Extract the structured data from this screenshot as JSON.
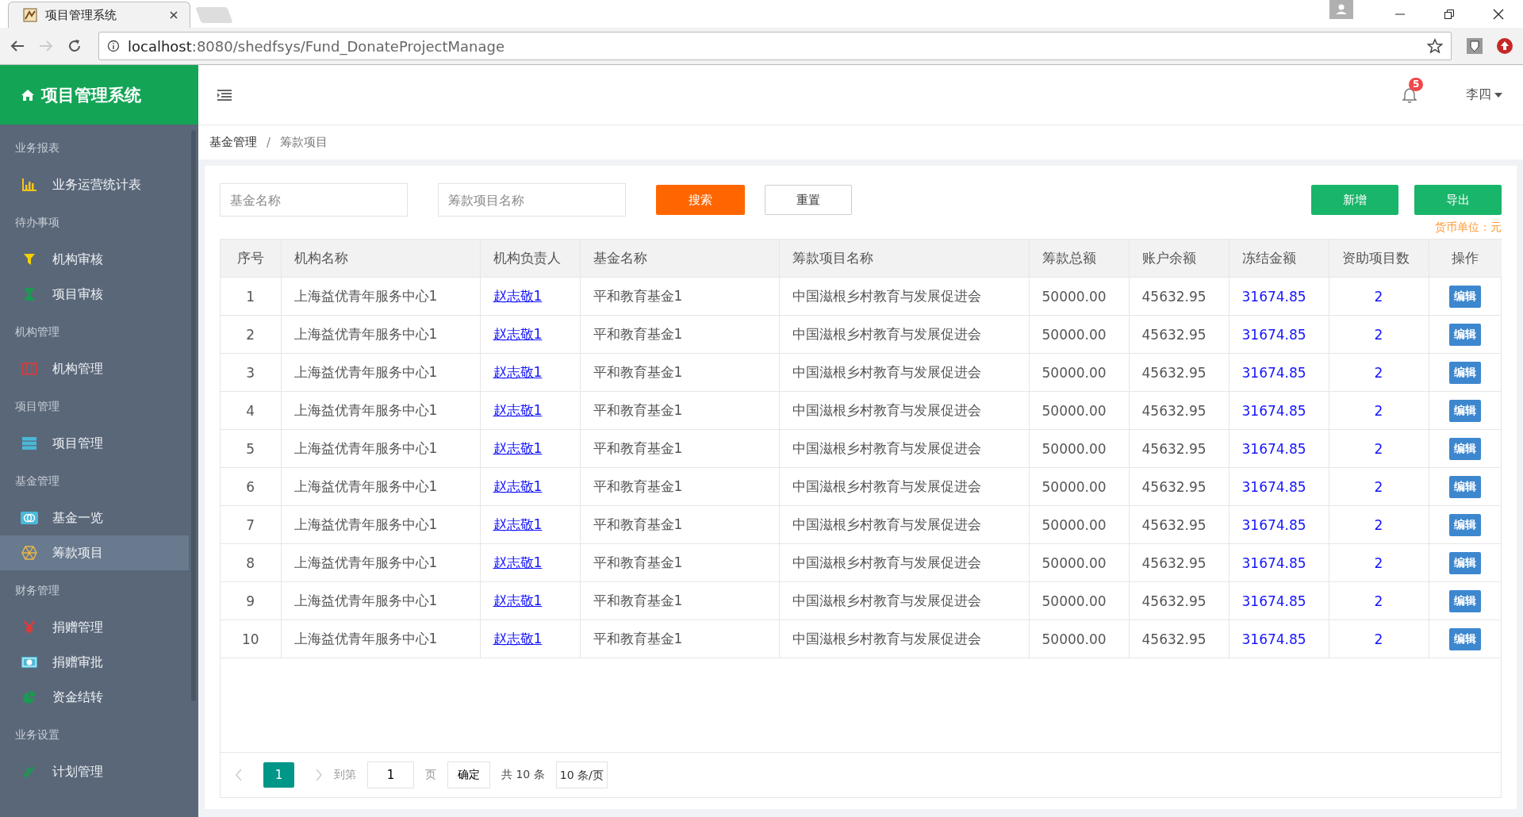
{
  "browser": {
    "tab_title": "项目管理系统",
    "url_host": "localhost",
    "url_path": ":8080/shedfsys/Fund_DonateProjectManage"
  },
  "app_title": "项目管理系统",
  "header": {
    "notification_count": "5",
    "user": "李四"
  },
  "sidebar": [
    {
      "label": "业务报表",
      "items": [
        {
          "label": "业务运营统计表",
          "color": "#f5c518",
          "selected": false
        }
      ]
    },
    {
      "label": "待办事项",
      "items": [
        {
          "label": "机构审核",
          "color": "#f5d000",
          "selected": false
        },
        {
          "label": "项目审核",
          "color": "#1a9a50",
          "selected": false
        }
      ]
    },
    {
      "label": "机构管理",
      "items": [
        {
          "label": "机构管理",
          "color": "#e53935",
          "selected": false
        }
      ]
    },
    {
      "label": "项目管理",
      "items": [
        {
          "label": "项目管理",
          "color": "#4ab8d8",
          "selected": false
        }
      ]
    },
    {
      "label": "基金管理",
      "items": [
        {
          "label": "基金一览",
          "color": "#4ab8d8",
          "selected": false
        },
        {
          "label": "筹款项目",
          "color": "#e8b84a",
          "selected": true
        }
      ]
    },
    {
      "label": "财务管理",
      "items": [
        {
          "label": "捐赠管理",
          "color": "#e53935",
          "selected": false
        },
        {
          "label": "捐赠审批",
          "color": "#4ab8d8",
          "selected": false
        },
        {
          "label": "资金结转",
          "color": "#1a9a50",
          "selected": false
        }
      ]
    },
    {
      "label": "业务设置",
      "items": [
        {
          "label": "计划管理",
          "color": "#1a9a50",
          "selected": false
        }
      ]
    }
  ],
  "breadcrumb": [
    "基金管理",
    "筹款项目"
  ],
  "breadcrumb_separator": "/",
  "filters": [
    {
      "placeholder": "基金名称"
    },
    {
      "placeholder": "筹款项目名称"
    }
  ],
  "buttons": {
    "search": "搜索",
    "reset": "重置",
    "add": "新增",
    "export": "导出"
  },
  "currency_note": "货币单位：元",
  "table": {
    "columns": [
      "序号",
      "机构名称",
      "机构负责人",
      "基金名称",
      "筹款项目名称",
      "筹款总额",
      "账户余额",
      "冻结金额",
      "资助项目数",
      "操作"
    ],
    "rows": [
      [
        "1",
        "上海益优青年服务中心1",
        "赵志敬1",
        "平和教育基金1",
        "中国滋根乡村教育与发展促进会",
        "50000.00",
        "45632.95",
        "31674.85",
        "2",
        "编辑"
      ],
      [
        "2",
        "上海益优青年服务中心1",
        "赵志敬1",
        "平和教育基金1",
        "中国滋根乡村教育与发展促进会",
        "50000.00",
        "45632.95",
        "31674.85",
        "2",
        "编辑"
      ],
      [
        "3",
        "上海益优青年服务中心1",
        "赵志敬1",
        "平和教育基金1",
        "中国滋根乡村教育与发展促进会",
        "50000.00",
        "45632.95",
        "31674.85",
        "2",
        "编辑"
      ],
      [
        "4",
        "上海益优青年服务中心1",
        "赵志敬1",
        "平和教育基金1",
        "中国滋根乡村教育与发展促进会",
        "50000.00",
        "45632.95",
        "31674.85",
        "2",
        "编辑"
      ],
      [
        "5",
        "上海益优青年服务中心1",
        "赵志敬1",
        "平和教育基金1",
        "中国滋根乡村教育与发展促进会",
        "50000.00",
        "45632.95",
        "31674.85",
        "2",
        "编辑"
      ],
      [
        "6",
        "上海益优青年服务中心1",
        "赵志敬1",
        "平和教育基金1",
        "中国滋根乡村教育与发展促进会",
        "50000.00",
        "45632.95",
        "31674.85",
        "2",
        "编辑"
      ],
      [
        "7",
        "上海益优青年服务中心1",
        "赵志敬1",
        "平和教育基金1",
        "中国滋根乡村教育与发展促进会",
        "50000.00",
        "45632.95",
        "31674.85",
        "2",
        "编辑"
      ],
      [
        "8",
        "上海益优青年服务中心1",
        "赵志敬1",
        "平和教育基金1",
        "中国滋根乡村教育与发展促进会",
        "50000.00",
        "45632.95",
        "31674.85",
        "2",
        "编辑"
      ],
      [
        "9",
        "上海益优青年服务中心1",
        "赵志敬1",
        "平和教育基金1",
        "中国滋根乡村教育与发展促进会",
        "50000.00",
        "45632.95",
        "31674.85",
        "2",
        "编辑"
      ],
      [
        "10",
        "上海益优青年服务中心1",
        "赵志敬1",
        "平和教育基金1",
        "中国滋根乡村教育与发展促进会",
        "50000.00",
        "45632.95",
        "31674.85",
        "2",
        "编辑"
      ]
    ]
  },
  "pagination": {
    "pages": [
      {
        "label": "1",
        "selected": true
      }
    ],
    "goto_label": "到第",
    "goto_value": "1",
    "page_unit": "页",
    "confirm": "确定",
    "total": "共 10 条",
    "page_size": "10 条/页"
  }
}
